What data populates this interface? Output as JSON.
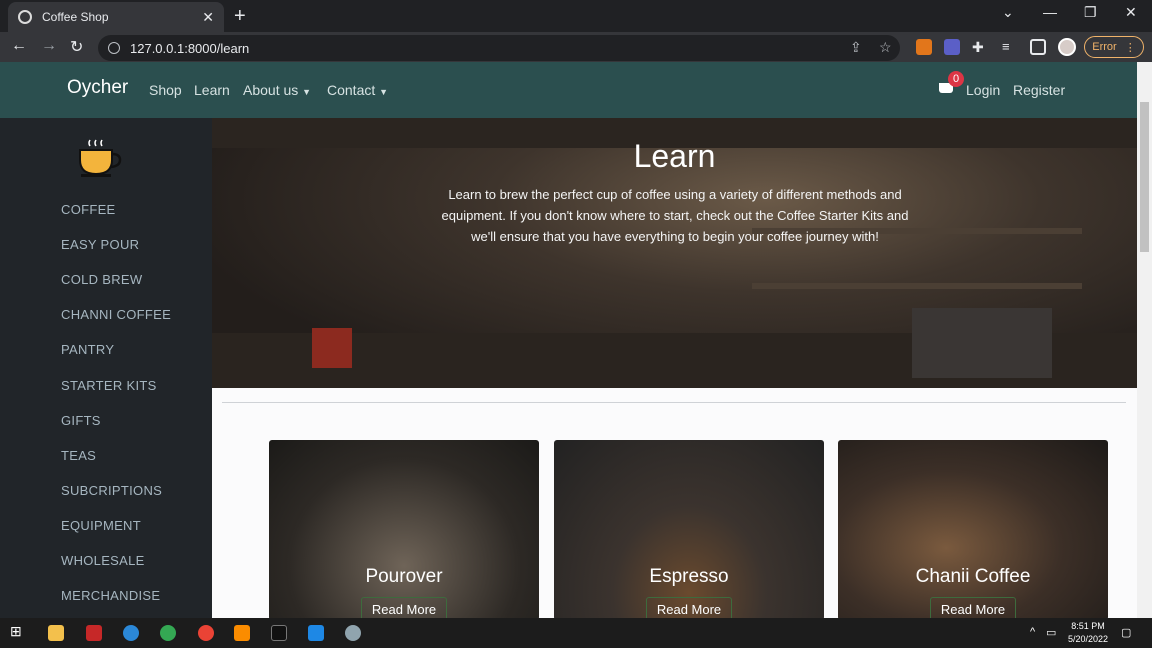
{
  "browser": {
    "tab_title": "Coffee Shop",
    "tab_close": "✕",
    "new_tab": "+",
    "url": "127.0.0.1:8000/learn",
    "error_label": "Error"
  },
  "navbar": {
    "brand": "Oycher",
    "links": [
      "Shop",
      "Learn",
      "About us",
      "Contact"
    ],
    "cart_count": "0",
    "login": "Login",
    "register": "Register"
  },
  "sidebar": {
    "items": [
      "COFFEE",
      "EASY POUR",
      "COLD BREW",
      "CHANNI COFFEE",
      "PANTRY",
      "STARTER KITS",
      "GIFTS",
      "TEAS",
      "SUBCRIPTIONS",
      "EQUIPMENT",
      "WHOLESALE",
      "MERCHANDISE"
    ]
  },
  "hero": {
    "title": "Learn",
    "text": "Learn to brew the perfect cup of coffee using a variety of different methods and equipment. If you don't know where to start, check out the Coffee Starter Kits and we'll ensure that you have everything to begin your coffee journey with!"
  },
  "cards": [
    {
      "title": "Pourover",
      "button": "Read More"
    },
    {
      "title": "Espresso",
      "button": "Read More"
    },
    {
      "title": "Chanii Coffee",
      "button": "Read More"
    }
  ],
  "taskbar": {
    "time": "8:51 PM",
    "date": "5/20/2022"
  },
  "colors": {
    "navbar": "#2b4f4f",
    "sidebar": "#212529",
    "badge": "#dc3545"
  }
}
